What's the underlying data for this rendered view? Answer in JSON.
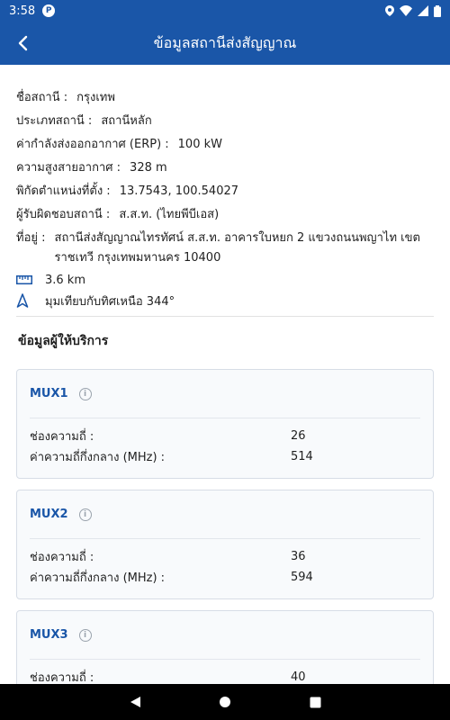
{
  "status_bar": {
    "time": "3:58",
    "app_badge": "P"
  },
  "app_bar": {
    "title": "ข้อมูลสถานีส่งสัญญาณ"
  },
  "station": {
    "name_label": "ชื่อสถานี :",
    "name_value": "กรุงเทพ",
    "type_label": "ประเภทสถานี :",
    "type_value": "สถานีหลัก",
    "erp_label": "ค่ากำลังส่งออกอากาศ (ERP) :",
    "erp_value": "100 kW",
    "height_label": "ความสูงสายอากาศ :",
    "height_value": "328 m",
    "coords_label": "พิกัดตำแหน่งที่ตั้ง :",
    "coords_value": "13.7543, 100.54027",
    "operator_label": "ผู้รับผิดชอบสถานี :",
    "operator_value": "ส.ส.ท. (ไทยพีบีเอส)",
    "address_label": "ที่อยู่ :",
    "address_value": "สถานีส่งสัญญาณไทรทัศน์ ส.ส.ท. อาคารใบหยก 2 แขวงถนนพญาไท เขตราชเทวี กรุงเทพมหานคร 10400",
    "distance": "3.6 km",
    "bearing": "มุมเทียบกับทิศเหนือ 344°"
  },
  "providers": {
    "title": "ข้อมูลผู้ให้บริการ",
    "channel_label": "ช่องความถี่ :",
    "freq_label": "ค่าความถี่กึ่งกลาง (MHz) :",
    "mux": [
      {
        "name": "MUX1",
        "channel": "26",
        "freq": "514"
      },
      {
        "name": "MUX2",
        "channel": "36",
        "freq": "594"
      },
      {
        "name": "MUX3",
        "channel": "40"
      }
    ]
  },
  "icons": {
    "back": "arrow-left-icon",
    "distance": "ruler-icon",
    "bearing": "navigation-arrow-icon",
    "info": "info-icon"
  },
  "colors": {
    "primary": "#1a56a8",
    "card_bg": "#f8fafc",
    "nav_bg": "#000000"
  }
}
